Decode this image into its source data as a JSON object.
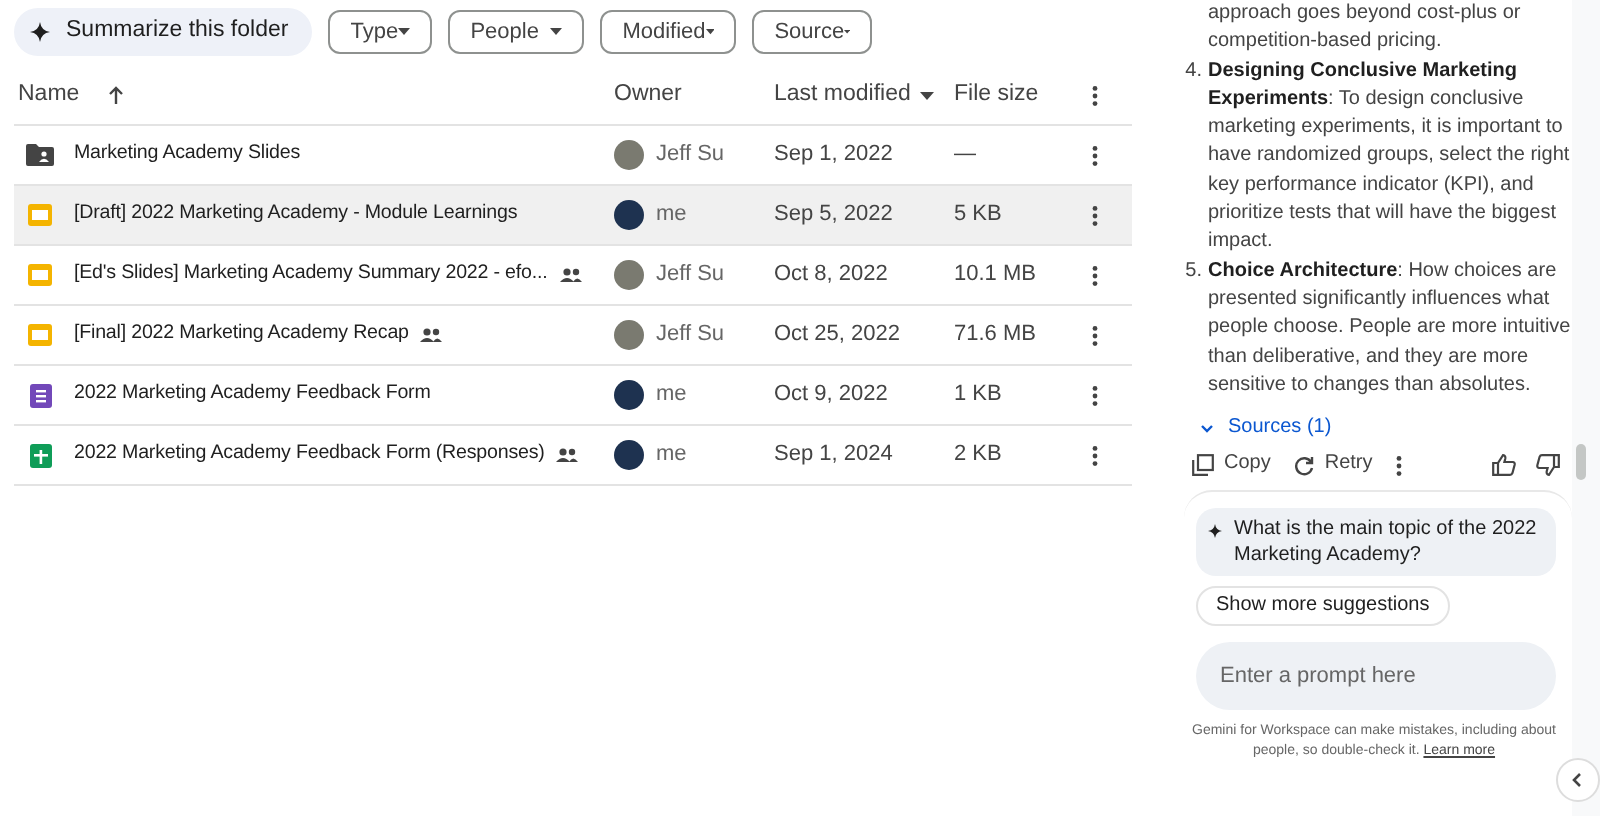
{
  "toolbar": {
    "summarize": "Summarize this folder",
    "filters": [
      "Type",
      "People",
      "Modified",
      "Source"
    ]
  },
  "table": {
    "columns": [
      {
        "label": "Name",
        "sorted": true,
        "menu": false
      },
      {
        "label": "Owner",
        "sorted": false,
        "menu": false
      },
      {
        "label": "Last modified",
        "sorted": false,
        "menu": true
      },
      {
        "label": "File size",
        "sorted": false,
        "menu": false
      }
    ],
    "rows": [
      {
        "kind": "folder",
        "name": "Marketing Academy Slides",
        "shared": false,
        "owner": "Jeff Su",
        "modified": "Sep 1, 2022",
        "size": "—",
        "selected": false
      },
      {
        "kind": "slides",
        "name": "[Draft] 2022 Marketing Academy - Module Learnings",
        "shared": false,
        "owner": "me",
        "modified": "Sep 5, 2022",
        "size": "5 KB",
        "selected": true
      },
      {
        "kind": "slides",
        "name": "[Ed's Slides] Marketing Academy Summary 2022 - efo...",
        "shared": true,
        "owner": "Jeff Su",
        "modified": "Oct 8, 2022",
        "size": "10.1 MB",
        "selected": false
      },
      {
        "kind": "slides",
        "name": "[Final] 2022 Marketing Academy Recap",
        "shared": true,
        "owner": "Jeff Su",
        "modified": "Oct 25, 2022",
        "size": "71.6 MB",
        "selected": false
      },
      {
        "kind": "forms",
        "name": "2022 Marketing Academy Feedback Form",
        "shared": false,
        "owner": "me",
        "modified": "Oct 9, 2022",
        "size": "1 KB",
        "selected": false
      },
      {
        "kind": "sheets",
        "name": "2022 Marketing Academy Feedback Form (Responses)",
        "shared": true,
        "owner": "me",
        "modified": "Sep 1, 2024",
        "size": "2 KB",
        "selected": false
      }
    ]
  },
  "gemini": {
    "intro": [
      "approach goes beyond cost-plus or",
      "competition-based pricing."
    ],
    "list": [
      {
        "number": "4.",
        "text": "**Designing Conclusive Marketing Experiments**: To design conclusive marketing experiments, it is important to have randomized groups, select the right key performance indicator (KPI), and prioritize tests that will have the biggest impact."
      },
      {
        "number": "5.",
        "text": "**Choice Architecture**: How choices are presented significantly influences what people choose. People are more intuitive than deliberative, and they are more sensitive to changes than absolutes."
      }
    ],
    "sources": "Sources (1)",
    "actions": [
      "Copy",
      "Retry"
    ],
    "suggestion": "What is the main topic of the 2022 Marketing Academy?",
    "more": "Show more suggestions",
    "prompt": {
      "placeholder": "Enter a prompt here"
    },
    "disclaimer": "Gemini for Workspace can make mistakes, including about people, so double-check it.",
    "learn_more": "Learn more"
  }
}
